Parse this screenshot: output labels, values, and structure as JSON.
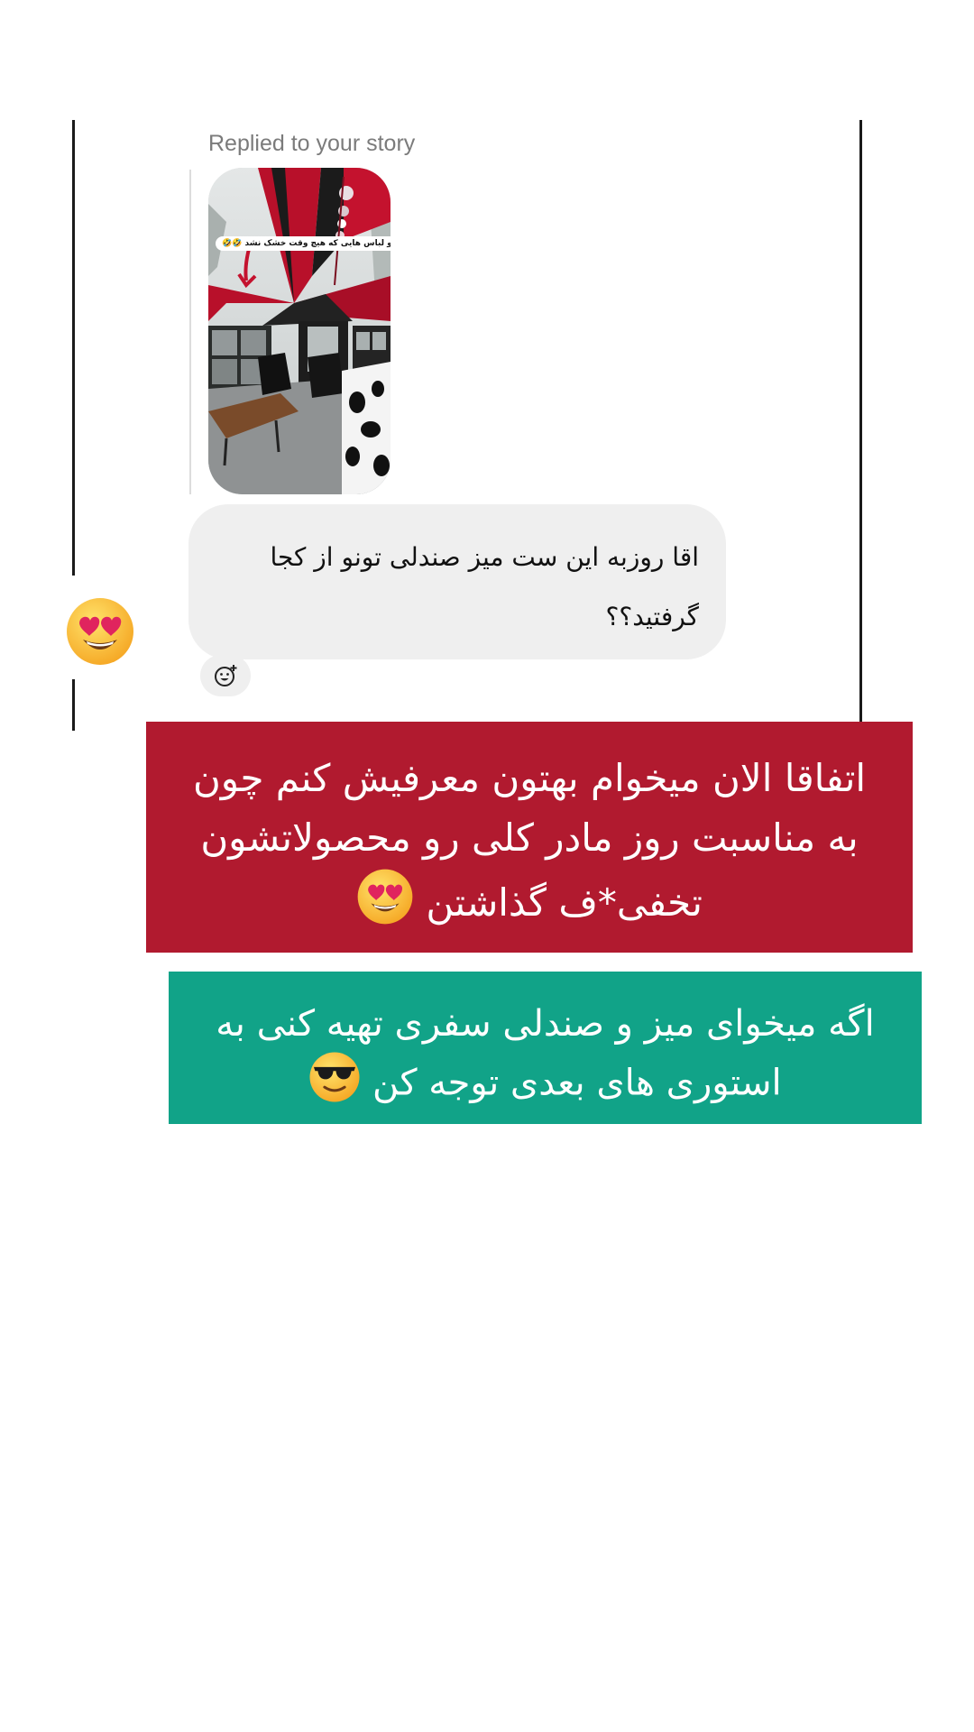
{
  "reply_context": {
    "caption": "Replied to your story"
  },
  "story": {
    "sticker_text": "و لباس هایی که هیچ وقت خشک نشد 🤣🤣"
  },
  "message": {
    "text": "اقا روزبه این ست میز صندلی تونو از کجا گرفتید؟؟",
    "reaction": "heart-eyes-emoji"
  },
  "overlay": {
    "red_banner": {
      "text": "اتفاقا الان میخوام بهتون معرفیش کنم چون به مناسبت روز مادر کلی رو محصولاتشون تخفی*ف گذاشتن",
      "emoji": "heart-eyes-emoji",
      "color": "#b11a2f"
    },
    "green_banner": {
      "text": "اگه میخوای میز و صندلی سفری تهیه کنی به استوری های بعدی توجه کن",
      "emoji": "sunglasses-emoji",
      "color": "#11a388"
    }
  }
}
